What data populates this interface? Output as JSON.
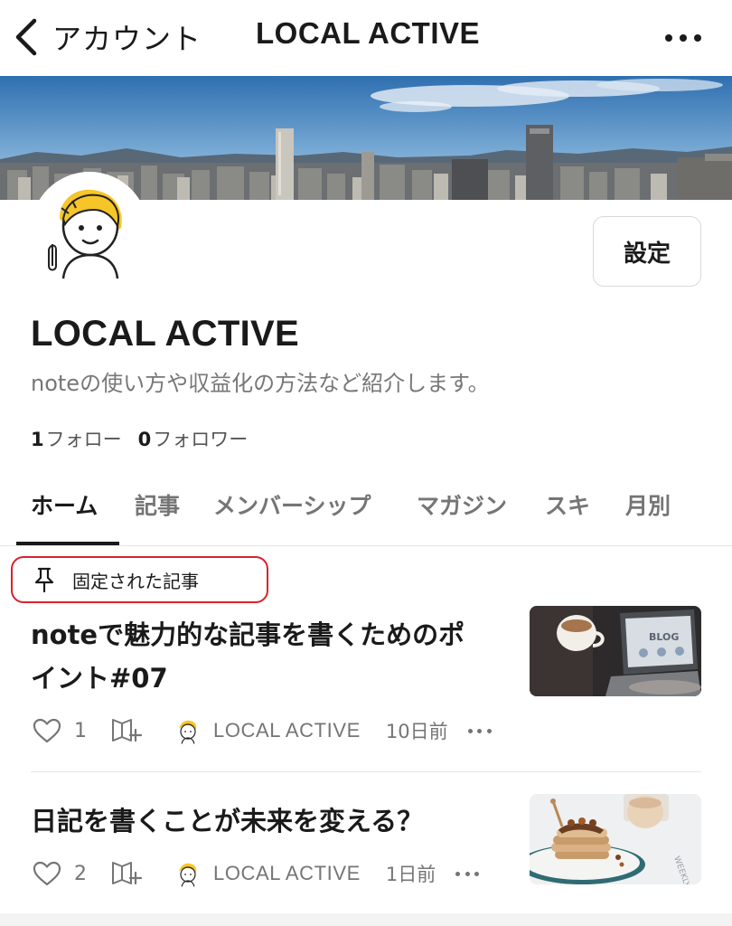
{
  "nav": {
    "back_label": "アカウント",
    "title": "LOCAL ACTIVE",
    "back_icon": "chevron-left-icon",
    "more_icon": "more-horizontal-icon"
  },
  "profile": {
    "name": "LOCAL ACTIVE",
    "bio": "noteの使い方や収益化の方法など紹介します。",
    "settings_label": "設定",
    "follow_count": "1",
    "follow_label": "フォロー",
    "follower_count": "0",
    "follower_label": "フォロワー"
  },
  "tabs": [
    {
      "label": "ホーム",
      "active": true
    },
    {
      "label": "記事",
      "active": false
    },
    {
      "label": "メンバーシップ",
      "active": false
    },
    {
      "label": "マガジン",
      "active": false
    },
    {
      "label": "スキ",
      "active": false
    },
    {
      "label": "月別",
      "active": false
    }
  ],
  "pinned": {
    "label": "固定された記事",
    "icon": "pin-icon",
    "highlight_color": "#d9222a"
  },
  "articles": [
    {
      "title_line1": "noteで魅力的な記事を書くためのポ",
      "title_line2": "イント#07",
      "likes": "1",
      "author": "LOCAL ACTIVE",
      "date": "10日前",
      "thumb_text": "BLOG"
    },
    {
      "title_line1": "日記を書くことが未来を変える？",
      "likes": "2",
      "author": "LOCAL ACTIVE",
      "date": "1日前"
    }
  ],
  "colors": {
    "text_primary": "#1a1a1a",
    "text_secondary": "#757575",
    "border": "#e6e6e6"
  }
}
